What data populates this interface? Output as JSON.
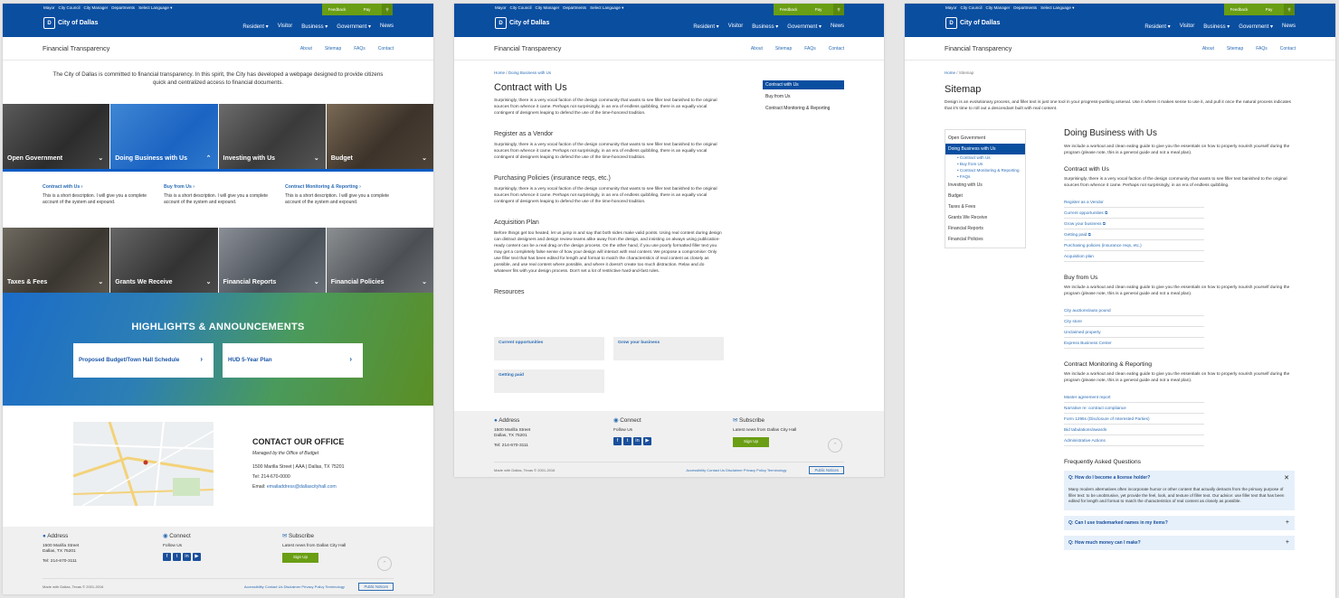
{
  "header": {
    "util_links": [
      "Mayor",
      "City Council",
      "City Manager",
      "Departments",
      "Select Language ▾"
    ],
    "feedback": "Feedback",
    "pay": "Pay",
    "logo": "City of Dallas",
    "nav": [
      "Resident ▾",
      "Visitor",
      "Business ▾",
      "Government ▾",
      "News"
    ]
  },
  "subheader": {
    "title": "Financial Transparency",
    "links": [
      "About",
      "Sitemap",
      "FAQs",
      "Contact"
    ]
  },
  "home": {
    "intro": "The City of Dallas is committed to financial transparency. In this spirit, the City has developed a webpage designed to provide citizens quick and centralized access to financial documents.",
    "tiles_row1": [
      "Open Government",
      "Doing Business with Us",
      "Investing with Us",
      "Budget"
    ],
    "tiles_row2": [
      "Taxes & Fees",
      "Grants We Receive",
      "Financial Reports",
      "Financial Policies"
    ],
    "subitems": [
      {
        "title": "Contract with Us",
        "desc": "This is a short description. I will give you a complete account of the system and expound."
      },
      {
        "title": "Buy from Us",
        "desc": "This is a short description. I will give you a complete account of the system and expound."
      },
      {
        "title": "Contract Monitoring & Reporting",
        "desc": "This is a short description. I will give you a complete account of the system and expound."
      }
    ],
    "highlights_title": "HIGHLIGHTS & ANNOUNCEMENTS",
    "cards": [
      "Proposed Budget/Town Hall Schedule",
      "HUD 5-Year Plan"
    ],
    "contact": {
      "title": "CONTACT OUR OFFICE",
      "sub": "Managed by the Office of Budget",
      "address": "1500 Marilla Street | AAA | Dallas, TX 75201",
      "tel": "Tel:  214-670-0000",
      "email_label": "Email:",
      "email": "emailaddress@dallascityhall.com"
    }
  },
  "footer": {
    "address_title": "Address",
    "address_l1": "1500 Marilla Street",
    "address_l2": "Dallas, TX 75201",
    "tel": "Tel: 214-670-3111",
    "connect_title": "Connect",
    "follow": "Follow Us",
    "subscribe_title": "Subscribe",
    "subscribe_text": "Latest news from Dallas City Hall",
    "signup": "Sign Up",
    "copyright": "Made with  Dallas, Texas © 2001-2016",
    "links": "Accessibility Contact Us Disclaimer Privacy Policy Terminology",
    "notices": "Public Notices"
  },
  "contract_page": {
    "breadcrumb_home": "Home",
    "breadcrumb_current": "Doing Business with Us",
    "title": "Contract with Us",
    "intro": "Surprisingly, there is a very vocal faction of the design community that wants to see filler text banished to the original sources from whence it came. Perhaps not surprisingly, in an era of endless quibbling, there is an equally vocal contingent of designers leaping to defend the use of the time-honored tradition.",
    "sections": [
      {
        "h": "Register as a Vendor",
        "p": "Surprisingly, there is a very vocal faction of the design community that wants to see filler text banished to the original sources from whence it came. Perhaps not surprisingly, in an era of endless quibbling, there is an equally vocal contingent of designers leaping to defend the use of the time-honored tradition."
      },
      {
        "h": "Purchasing Policies (insurance reqs, etc.)",
        "p": "Surprisingly, there is a very vocal faction of the design community that wants to see filler text banished to the original sources from whence it came. Perhaps not surprisingly, in an era of endless quibbling, there is an equally vocal contingent of designers leaping to defend the use of the time-honored tradition."
      },
      {
        "h": "Acquisition Plan",
        "p": "Before things get too heated, let us jump in and say that both sides make valid points. Using real content during design can distract designers and design review teams alike away from the design, and insisting on always using publication-ready content can be a real drag on the design process. On the other hand, if you use poorly formatted filler text you may get a completely false sense of how your design will interact with real content. We propose a compromise: Only use filler text that has been edited for length and format to match the characteristics of real content as closely as possible, and use real content where possible, and where it doesn't create too much distraction. Relax and do whatever fits with your design process. Don't set a lot of restrictive hard-and-fast rules."
      }
    ],
    "resources_title": "Resources",
    "resources": [
      "Current opportunities",
      "Grow your business",
      "Getting paid"
    ],
    "sidenav": [
      "Contract with Us",
      "Buy from Us",
      "Contract Monitoring & Reporting"
    ]
  },
  "sitemap": {
    "breadcrumb_home": "Home",
    "breadcrumb_current": "Sitemap",
    "title": "Sitemap",
    "intro": "Design is an evolutionary process, and filler text is just one tool in your progress-pushing arsenal. Use it where it makes sense to use it, and pull it once the natural process indicates that it's time to roll out a descendant built with real content.",
    "nav": {
      "open_gov": "Open Government",
      "active": "Doing Business with Us",
      "subs": [
        "Contract with Us",
        "Buy from Us",
        "Contract Monitoring & Reporting",
        "FAQs"
      ],
      "rest": [
        "Investing with Us",
        "Budget",
        "Taxes & Fees",
        "Grants We Receive",
        "Financial Reports",
        "Financial Policies"
      ]
    },
    "main_title": "Doing Business with Us",
    "main_intro": "We include a workout and clean eating guide to give you the essentials on how to properly nourish yourself during the program (please note, this is a general guide and not a meal plan).",
    "contract_title": "Contract with Us",
    "contract_text": "Surprisingly, there is a very vocal faction of the design community that wants to see filler text banished to the original sources from whence it came. Perhaps not surprisingly, in an era of endless quibbling.",
    "contract_links": [
      "Register as a Vendor",
      "Current opportunities ⧉",
      "Grow your business ⧉",
      "Getting paid ⧉",
      "Purchasing policies (insurance reqs, etc.)",
      "Acquisition plan"
    ],
    "buy_title": "Buy from Us",
    "buy_text": "We include a workout and clean eating guide to give you the essentials on how to properly nourish yourself during the program (please note, this is a general guide and not a meal plan).",
    "buy_links": [
      "City auctions/auto pound",
      "City store",
      "Unclaimed property",
      "Express Business Center"
    ],
    "cmr_title": "Contract Monitoring & Reporting",
    "cmr_text": "We include a workout and clean eating guide to give you the essentials on how to properly nourish yourself during the program (please note, this is a general guide and not a meal plan).",
    "cmr_links": [
      "Master agreement report",
      "Narrative re: contract compliance",
      "Form 1295s (Disclosure of Interested Parties)",
      "Bid tabulations/awards",
      "Administrative Actions"
    ],
    "faq_title": "Frequently Asked Questions",
    "faqs": [
      {
        "q": "Q: How do I become a license holder?",
        "a": "Many modern alternatives often incorporate humor or other content that actually detracts from the primary purpose of filler text: to be unobtrusive, yet provide the feel, look, and texture of filler text. Our advice: use filler text that has been edited for length and format to match the characteristics of real content as closely as possible."
      },
      {
        "q": "Q: Can I use trademarked names in my items?"
      },
      {
        "q": "Q: How much money can I make?"
      }
    ]
  }
}
